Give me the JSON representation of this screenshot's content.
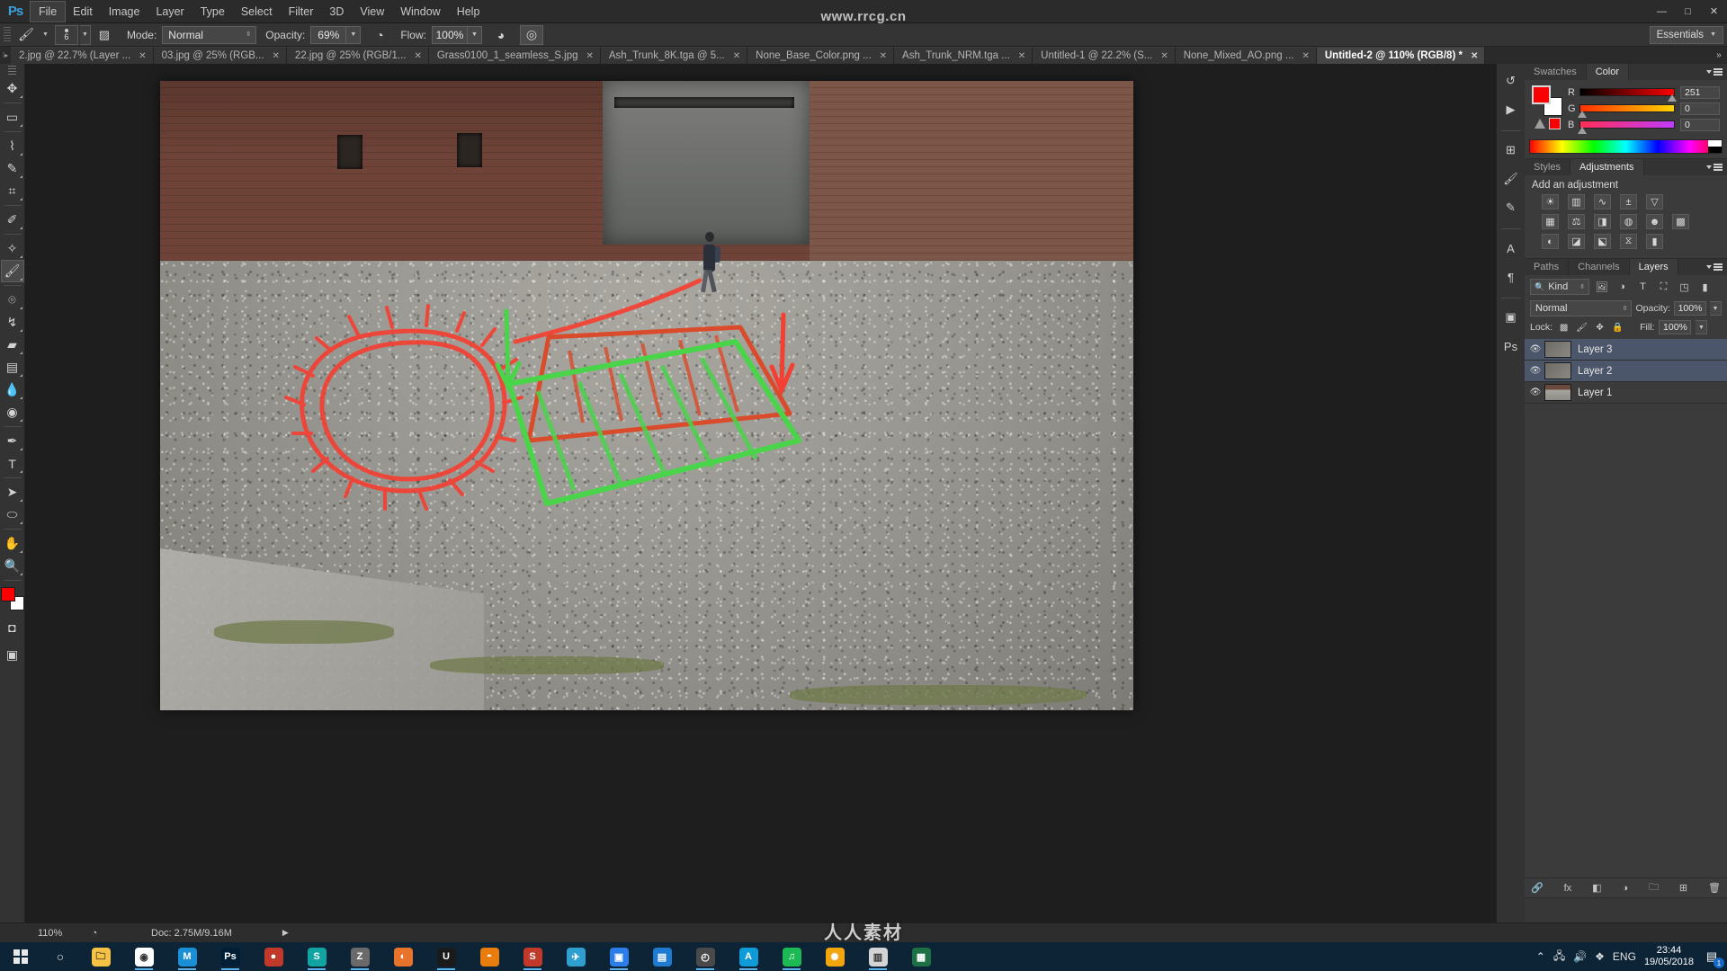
{
  "window": {
    "watermark_top": "www.rrcg.cn",
    "watermark_bottom": "人人素材",
    "minimize": "—",
    "maximize": "□",
    "close": "✕"
  },
  "menubar": {
    "logo": "Ps",
    "items": [
      {
        "label": "File",
        "active": true
      },
      {
        "label": "Edit",
        "active": false
      },
      {
        "label": "Image",
        "active": false
      },
      {
        "label": "Layer",
        "active": false
      },
      {
        "label": "Type",
        "active": false
      },
      {
        "label": "Select",
        "active": false
      },
      {
        "label": "Filter",
        "active": false
      },
      {
        "label": "3D",
        "active": false
      },
      {
        "label": "View",
        "active": false
      },
      {
        "label": "Window",
        "active": false
      },
      {
        "label": "Help",
        "active": false
      }
    ]
  },
  "options_bar": {
    "tool_icon": "brush-icon",
    "brush_size": "6",
    "brush_panel_icon": "brush-panel-icon",
    "mode_label": "Mode:",
    "mode_value": "Normal",
    "opacity_label": "Opacity:",
    "opacity_value": "69%",
    "pressure_opacity_icon": "pressure-opacity-icon",
    "flow_label": "Flow:",
    "flow_value": "100%",
    "pressure_size_icon": "pressure-size-icon",
    "airbrush_icon": "airbrush-icon",
    "workspace": "Essentials"
  },
  "tabs": [
    {
      "label": "2.jpg @ 22.7% (Layer ...",
      "active": false
    },
    {
      "label": "03.jpg @ 25% (RGB...",
      "active": false
    },
    {
      "label": "22.jpg @ 25% (RGB/1...",
      "active": false
    },
    {
      "label": "Grass0100_1_seamless_S.jpg",
      "active": false
    },
    {
      "label": "Ash_Trunk_8K.tga @ 5...",
      "active": false
    },
    {
      "label": "None_Base_Color.png ...",
      "active": false
    },
    {
      "label": "Ash_Trunk_NRM.tga ...",
      "active": false
    },
    {
      "label": "Untitled-1 @ 22.2% (S...",
      "active": false
    },
    {
      "label": "None_Mixed_AO.png ...",
      "active": false
    },
    {
      "label": "Untitled-2 @ 110% (RGB/8) *",
      "active": true
    }
  ],
  "tabs_overflow_icon": "chevron-double-right-icon",
  "toolbox": {
    "tools": [
      {
        "name": "move-tool",
        "glyph": "✥",
        "selected": false
      },
      {
        "name": "rectangular-marquee-tool",
        "glyph": "▭",
        "selected": false
      },
      {
        "name": "lasso-tool",
        "glyph": "⌇",
        "selected": false
      },
      {
        "name": "quick-selection-tool",
        "glyph": "✎",
        "selected": false
      },
      {
        "name": "crop-tool",
        "glyph": "⌗",
        "selected": false
      },
      {
        "name": "eyedropper-tool",
        "glyph": "✐",
        "selected": false
      },
      {
        "name": "spot-healing-brush-tool",
        "glyph": "✧",
        "selected": false
      },
      {
        "name": "brush-tool",
        "glyph": "🖌",
        "selected": true
      },
      {
        "name": "clone-stamp-tool",
        "glyph": "⌾",
        "selected": false
      },
      {
        "name": "history-brush-tool",
        "glyph": "↯",
        "selected": false
      },
      {
        "name": "eraser-tool",
        "glyph": "▰",
        "selected": false
      },
      {
        "name": "gradient-tool",
        "glyph": "▤",
        "selected": false
      },
      {
        "name": "blur-tool",
        "glyph": "💧",
        "selected": false
      },
      {
        "name": "dodge-tool",
        "glyph": "◉",
        "selected": false
      },
      {
        "name": "pen-tool",
        "glyph": "✒",
        "selected": false
      },
      {
        "name": "type-tool",
        "glyph": "T",
        "selected": false
      },
      {
        "name": "path-selection-tool",
        "glyph": "➤",
        "selected": false
      },
      {
        "name": "ellipse-tool",
        "glyph": "⬭",
        "selected": false
      },
      {
        "name": "hand-tool",
        "glyph": "✋",
        "selected": false
      },
      {
        "name": "zoom-tool",
        "glyph": "🔍",
        "selected": false
      }
    ],
    "foreground_color": "#fb0000",
    "background_color": "#ffffff",
    "quick_mask_icon": "quick-mask-icon",
    "screen_mode_icon": "screen-mode-icon"
  },
  "right_strip_icons": [
    "history-icon",
    "actions-icon",
    "properties-icon",
    "brushes-icon",
    "brush-settings-icon",
    "character-icon",
    "paragraph-icon",
    "libraries-icon",
    "psd-icon"
  ],
  "color_panel": {
    "tabs": [
      {
        "label": "Color",
        "active": true
      },
      {
        "label": "Swatches",
        "active": false
      }
    ],
    "channels": [
      {
        "label": "R",
        "value": "251",
        "percent": 98
      },
      {
        "label": "G",
        "value": "0",
        "percent": 2
      },
      {
        "label": "B",
        "value": "0",
        "percent": 2
      }
    ],
    "foreground": "#fb0000",
    "background": "#ffffff",
    "out_of_gamut_icon": "out-of-gamut-warning-icon"
  },
  "adjustments_panel": {
    "tabs": [
      {
        "label": "Adjustments",
        "active": true
      },
      {
        "label": "Styles",
        "active": false
      }
    ],
    "title": "Add an adjustment",
    "rows": [
      [
        {
          "name": "brightness-contrast-icon",
          "glyph": "☀"
        },
        {
          "name": "levels-icon",
          "glyph": "▥"
        },
        {
          "name": "curves-icon",
          "glyph": "∿"
        },
        {
          "name": "exposure-icon",
          "glyph": "±"
        },
        {
          "name": "vibrance-icon",
          "glyph": "▽"
        }
      ],
      [
        {
          "name": "hue-saturation-icon",
          "glyph": "▦"
        },
        {
          "name": "color-balance-icon",
          "glyph": "⚖"
        },
        {
          "name": "black-white-icon",
          "glyph": "◨"
        },
        {
          "name": "photo-filter-icon",
          "glyph": "◍"
        },
        {
          "name": "channel-mixer-icon",
          "glyph": "☻"
        },
        {
          "name": "color-lookup-icon",
          "glyph": "▩"
        }
      ],
      [
        {
          "name": "invert-icon",
          "glyph": "◐"
        },
        {
          "name": "posterize-icon",
          "glyph": "◪"
        },
        {
          "name": "threshold-icon",
          "glyph": "⬕"
        },
        {
          "name": "selective-color-icon",
          "glyph": "⧖"
        },
        {
          "name": "gradient-map-icon",
          "glyph": "▮"
        }
      ]
    ]
  },
  "layers_panel": {
    "tabs": [
      {
        "label": "Layers",
        "active": true
      },
      {
        "label": "Channels",
        "active": false
      },
      {
        "label": "Paths",
        "active": false
      }
    ],
    "filter_label": "Kind",
    "filter_icons": [
      "pixel-filter-icon",
      "adjustment-filter-icon",
      "type-filter-icon",
      "shape-filter-icon",
      "smartobject-filter-icon"
    ],
    "filter_toggle_icon": "filter-toggle-icon",
    "blend_mode": "Normal",
    "opacity_label": "Opacity:",
    "opacity_value": "100%",
    "lock_label": "Lock:",
    "lock_icons": [
      "lock-transparent-pixels-icon",
      "lock-image-pixels-icon",
      "lock-position-icon",
      "lock-all-icon"
    ],
    "fill_label": "Fill:",
    "fill_value": "100%",
    "layers": [
      {
        "name": "Layer 3",
        "visible": true,
        "selected": true,
        "thumb": "green-strokes"
      },
      {
        "name": "Layer 2",
        "visible": true,
        "selected": true,
        "thumb": "red-strokes"
      },
      {
        "name": "Layer 1",
        "visible": true,
        "selected": false,
        "thumb": "photo"
      }
    ],
    "bottom_icons": [
      "link-layers-icon",
      "layer-style-icon",
      "layer-mask-icon",
      "new-fill-layer-icon",
      "new-group-icon",
      "new-layer-icon",
      "delete-layer-icon"
    ]
  },
  "status_bar": {
    "zoom": "110%",
    "doc_icon": "doc-info-icon",
    "doc_info": "Doc: 2.75M/9.16M",
    "expand_arrow": "▶"
  },
  "taskbar": {
    "start_icon": "windows-start-icon",
    "search_icon": "search-icon",
    "apps": [
      {
        "name": "file-explorer",
        "glyph": "🗀",
        "color": "#f6c244",
        "running": false
      },
      {
        "name": "chrome",
        "glyph": "◉",
        "color": "#ffffff",
        "running": true
      },
      {
        "name": "marvelous-designer",
        "glyph": "M",
        "color": "#1b8fd6",
        "running": true
      },
      {
        "name": "photoshop",
        "glyph": "Ps",
        "color": "#001e36",
        "running": true
      },
      {
        "name": "media-player",
        "glyph": "●",
        "color": "#c0392b",
        "running": false
      },
      {
        "name": "substance-painter",
        "glyph": "S",
        "color": "#12a3a3",
        "running": true
      },
      {
        "name": "zbrush",
        "glyph": "Z",
        "color": "#6a6a6a",
        "running": true
      },
      {
        "name": "firefox",
        "glyph": "◐",
        "color": "#e8732b",
        "running": false
      },
      {
        "name": "unreal-engine",
        "glyph": "U",
        "color": "#1a1a1a",
        "running": true
      },
      {
        "name": "blender",
        "glyph": "◓",
        "color": "#e87d0d",
        "running": false
      },
      {
        "name": "substance-designer",
        "glyph": "S",
        "color": "#c0392b",
        "running": true
      },
      {
        "name": "telegram",
        "glyph": "✈",
        "color": "#2f9fd0",
        "running": false
      },
      {
        "name": "quixel-bridge",
        "glyph": "▣",
        "color": "#2b7de9",
        "running": true
      },
      {
        "name": "quixel-mixer",
        "glyph": "▤",
        "color": "#1f7bd0",
        "running": false
      },
      {
        "name": "3ds-max",
        "glyph": "◴",
        "color": "#4a4a4a",
        "running": true
      },
      {
        "name": "autodesk-maya",
        "glyph": "A",
        "color": "#0f9bd7",
        "running": true
      },
      {
        "name": "spotify",
        "glyph": "♫",
        "color": "#1db954",
        "running": true
      },
      {
        "name": "keyshot",
        "glyph": "✺",
        "color": "#f2a50c",
        "running": false
      },
      {
        "name": "gallery",
        "glyph": "▥",
        "color": "#d4d4d4",
        "running": true
      },
      {
        "name": "excel",
        "glyph": "▦",
        "color": "#1d7044",
        "running": false
      }
    ],
    "tray": {
      "chevron": "⌃",
      "network_icon": "network-icon",
      "volume_icon": "volume-icon",
      "dropbox_icon": "dropbox-icon",
      "language": "ENG",
      "time": "23:44",
      "date": "19/05/2018",
      "notifications_icon": "notifications-icon",
      "notifications_count": "1"
    }
  },
  "canvas": {
    "annotations": {
      "red_circle_label": "red-circle-annotation",
      "red_leader_line_label": "red-leader-line",
      "green_arrow_left_label": "green-down-arrow",
      "red_arrow_right_label": "red-down-arrow",
      "red_quad_label": "red-quad-annotation",
      "green_quad_label": "green-quad-annotation"
    }
  }
}
